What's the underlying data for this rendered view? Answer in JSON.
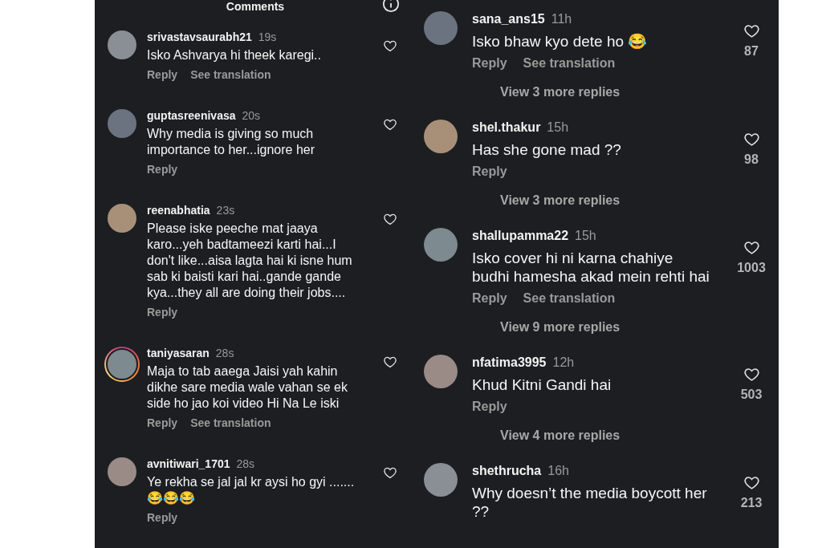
{
  "header": {
    "title": "Comments"
  },
  "columns": [
    {
      "comments": [
        {
          "username": "srivastavsaurabh21",
          "time": "19s",
          "text": "Isko Ashvarya hi theek karegi..",
          "actions": [
            "Reply",
            "See translation"
          ],
          "story_ring": false
        },
        {
          "username": "guptasreenivasa",
          "time": "20s",
          "text": "Why media is giving so much importance to her...ignore her",
          "actions": [
            "Reply"
          ],
          "story_ring": false
        },
        {
          "username": "reenabhatia",
          "time": "23s",
          "text": "Please iske peeche mat jaaya karo...yeh badtameezi karti hai...I don't like...aisa lagta hai ki isne hum sab ki baisti kari hai..gande gande kya...they all are doing their jobs....",
          "actions": [
            "Reply"
          ],
          "story_ring": false
        },
        {
          "username": "taniyasaran",
          "time": "28s",
          "text": "Maja to tab aaega Jaisi yah kahin dikhe sare media wale vahan se ek side ho jao koi video Hi Na Le iski",
          "actions": [
            "Reply",
            "See translation"
          ],
          "story_ring": true
        },
        {
          "username": "avnitiwari_1701",
          "time": "28s",
          "text": "Ye rekha se jal jal kr aysi ho gyi .......😂😂😂",
          "actions": [
            "Reply"
          ],
          "story_ring": false
        }
      ]
    },
    {
      "comments": [
        {
          "username": "sana_ans15",
          "time": "11h",
          "text": "Isko bhaw kyo dete ho 😂",
          "actions": [
            "Reply",
            "See translation"
          ],
          "likes": "87",
          "more_replies": "View 3 more replies",
          "story_ring": false
        },
        {
          "username": "shel.thakur",
          "time": "15h",
          "text": "Has she gone mad ??",
          "actions": [
            "Reply"
          ],
          "likes": "98",
          "more_replies": "View 3 more replies",
          "story_ring": false
        },
        {
          "username": "shallupamma22",
          "time": "15h",
          "text": "Isko cover hi ni karna chahiye budhi hamesha akad mein rehti hai",
          "actions": [
            "Reply",
            "See translation"
          ],
          "likes": "1003",
          "more_replies": "View 9 more replies",
          "story_ring": false
        },
        {
          "username": "nfatima3995",
          "time": "12h",
          "text": "Khud Kitni Gandi hai",
          "actions": [
            "Reply"
          ],
          "likes": "503",
          "more_replies": "View 4 more replies",
          "story_ring": false
        },
        {
          "username": "shethrucha",
          "time": "16h",
          "text": "Why doesn’t the media boycott her ??",
          "likes": "213",
          "story_ring": false
        }
      ]
    }
  ]
}
